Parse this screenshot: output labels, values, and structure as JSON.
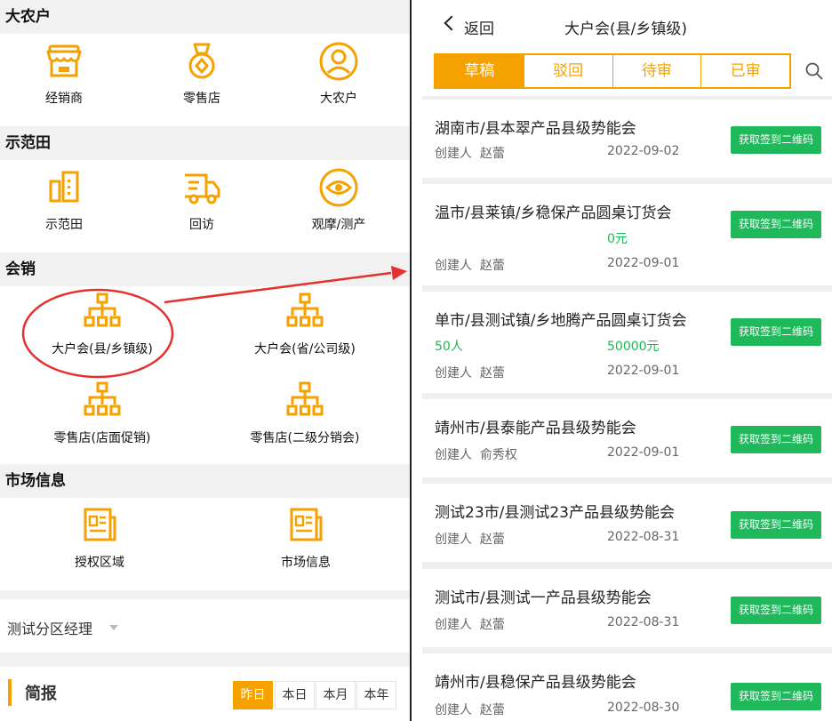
{
  "left": {
    "sections": {
      "big_farmer": {
        "title": "大农户",
        "items": [
          "经销商",
          "零售店",
          "大农户"
        ]
      },
      "demo_field": {
        "title": "示范田",
        "items": [
          "示范田",
          "回访",
          "观摩/测产"
        ]
      },
      "meetings": {
        "title": "会销",
        "items": [
          "大户会(县/乡镇级)",
          "大户会(省/公司级)",
          "零售店(店面促销)",
          "零售店(二级分销会)"
        ]
      },
      "market": {
        "title": "市场信息",
        "items": [
          "授权区域",
          "市场信息"
        ]
      }
    },
    "filter": "测试分区经理",
    "brief": {
      "title": "简报",
      "periods": [
        "昨日",
        "本日",
        "本月",
        "本年"
      ],
      "selected": "昨日"
    }
  },
  "right": {
    "back_label": "返回",
    "page_title": "大户会(县/乡镇级)",
    "tabs": [
      "草稿",
      "驳回",
      "待审",
      "已审"
    ],
    "active_tab": "草稿",
    "creator_label": "创建人",
    "qr_button": "获取签到二维码",
    "records": [
      {
        "title": "湖南市/县本翠产品县级势能会",
        "creator": "赵蕾",
        "date": "2022-09-02"
      },
      {
        "title": "温市/县莱镇/乡稳保产品圆桌订货会",
        "amount": "0元",
        "creator": "赵蕾",
        "date": "2022-09-01"
      },
      {
        "title": "单市/县测试镇/乡地腾产品圆桌订货会",
        "people": "50人",
        "amount": "50000元",
        "creator": "赵蕾",
        "date": "2022-09-01"
      },
      {
        "title": "靖州市/县泰能产品县级势能会",
        "creator": "俞秀权",
        "date": "2022-09-01"
      },
      {
        "title": "测试23市/县测试23产品县级势能会",
        "creator": "赵蕾",
        "date": "2022-08-31"
      },
      {
        "title": "测试市/县测试一产品县级势能会",
        "creator": "赵蕾",
        "date": "2022-08-31"
      },
      {
        "title": "靖州市/县稳保产品县级势能会",
        "creator": "赵蕾",
        "date": "2022-08-30"
      }
    ]
  },
  "colors": {
    "accent": "#f5a200",
    "green": "#1fb85a",
    "annotation_red": "#e53030"
  }
}
